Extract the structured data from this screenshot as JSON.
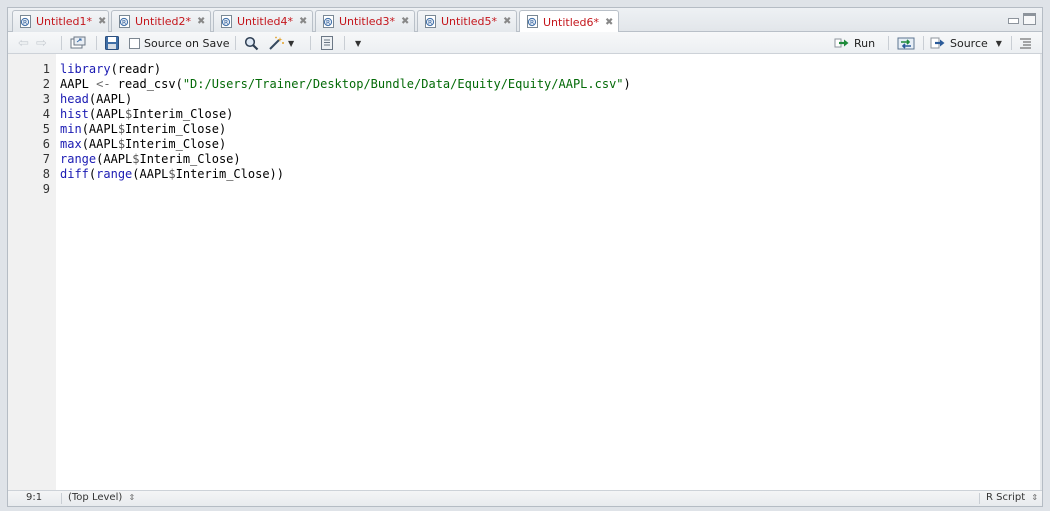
{
  "tabs": [
    {
      "label": "Untitled1*",
      "active": false
    },
    {
      "label": "Untitled2*",
      "active": false
    },
    {
      "label": "Untitled4*",
      "active": false
    },
    {
      "label": "Untitled3*",
      "active": false
    },
    {
      "label": "Untitled5*",
      "active": false
    },
    {
      "label": "Untitled6*",
      "active": true
    }
  ],
  "toolbar": {
    "source_on_save_label": "Source on Save",
    "run_label": "Run",
    "source_label": "Source"
  },
  "editor": {
    "line_numbers": [
      "1",
      "2",
      "3",
      "4",
      "5",
      "6",
      "7",
      "8",
      "9"
    ],
    "lines": [
      [
        {
          "t": "library",
          "c": "kw"
        },
        {
          "t": "(readr)",
          "c": ""
        }
      ],
      [
        {
          "t": "AAPL ",
          "c": ""
        },
        {
          "t": "<-",
          "c": "op"
        },
        {
          "t": " read_csv(",
          "c": ""
        },
        {
          "t": "\"D:/Users/Trainer/Desktop/Bundle/Data/Equity/Equity/AAPL.csv\"",
          "c": "str"
        },
        {
          "t": ")",
          "c": ""
        }
      ],
      [
        {
          "t": "head",
          "c": "kw"
        },
        {
          "t": "(AAPL)",
          "c": ""
        }
      ],
      [
        {
          "t": "hist",
          "c": "kw"
        },
        {
          "t": "(AAPL",
          "c": ""
        },
        {
          "t": "$",
          "c": "dl"
        },
        {
          "t": "Interim_Close)",
          "c": ""
        }
      ],
      [
        {
          "t": "min",
          "c": "kw"
        },
        {
          "t": "(AAPL",
          "c": ""
        },
        {
          "t": "$",
          "c": "dl"
        },
        {
          "t": "Interim_Close)",
          "c": ""
        }
      ],
      [
        {
          "t": "max",
          "c": "kw"
        },
        {
          "t": "(AAPL",
          "c": ""
        },
        {
          "t": "$",
          "c": "dl"
        },
        {
          "t": "Interim_Close)",
          "c": ""
        }
      ],
      [
        {
          "t": "range",
          "c": "kw"
        },
        {
          "t": "(AAPL",
          "c": ""
        },
        {
          "t": "$",
          "c": "dl"
        },
        {
          "t": "Interim_Close)",
          "c": ""
        }
      ],
      [
        {
          "t": "diff",
          "c": "kw"
        },
        {
          "t": "(",
          "c": ""
        },
        {
          "t": "range",
          "c": "kw"
        },
        {
          "t": "(AAPL",
          "c": ""
        },
        {
          "t": "$",
          "c": "dl"
        },
        {
          "t": "Interim_Close))",
          "c": ""
        }
      ],
      []
    ]
  },
  "status": {
    "cursor": "9:1",
    "scope": "(Top Level)",
    "language": "R Script"
  },
  "icons": {
    "back": "back-arrow-icon",
    "forward": "forward-arrow-icon",
    "show_in_window": "show-in-window-icon",
    "save": "save-icon",
    "search": "search-icon",
    "wand": "magic-wand-icon",
    "compile": "compile-report-icon",
    "run": "run-arrow-icon",
    "rerun": "rerun-icon",
    "source": "source-icon",
    "outline": "outline-icon"
  },
  "colors": {
    "tab_label": "#c4161c",
    "keyword": "#1b1bb3",
    "string": "#036a07"
  }
}
